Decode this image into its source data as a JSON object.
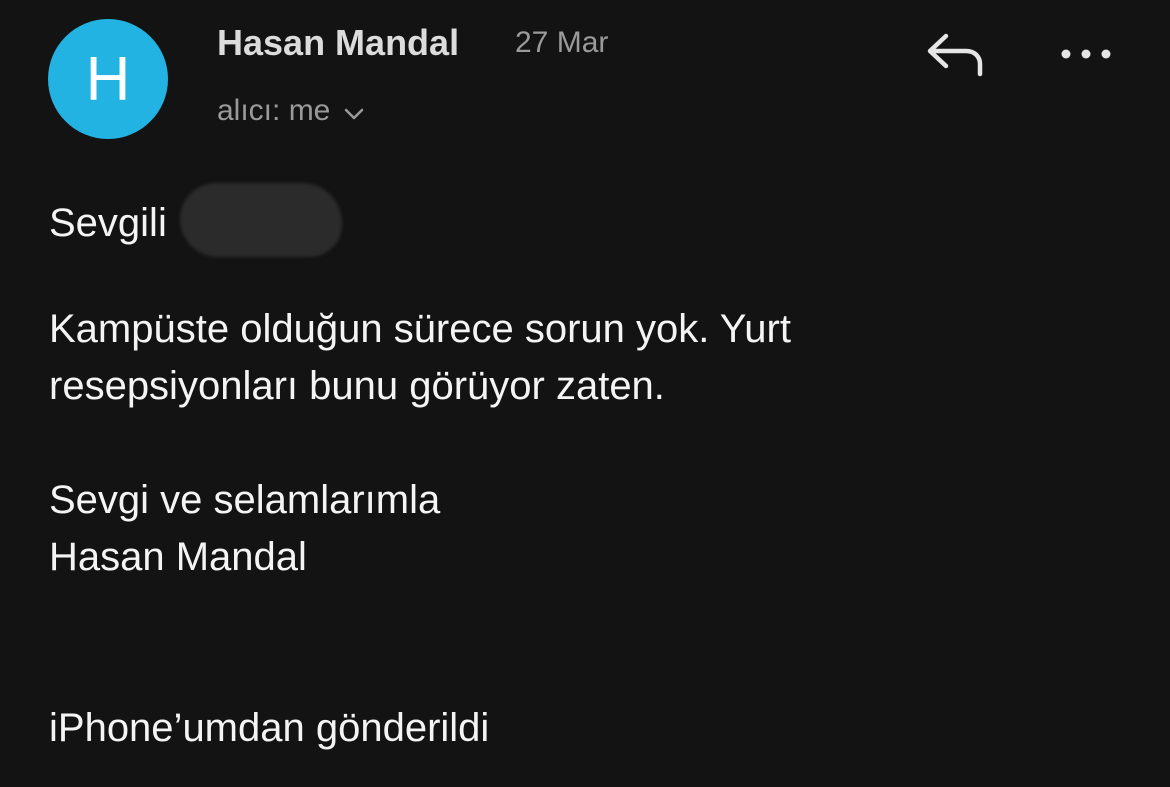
{
  "header": {
    "avatar_letter": "H",
    "avatar_color": "#22b3e2",
    "sender_name": "Hasan Mandal",
    "date": "27 Mar",
    "recipient": "alıcı: me",
    "recipient_toggle_icon": "chevron-down-icon",
    "reply_icon": "reply-icon",
    "more_icon": "more-horizontal-icon"
  },
  "message": {
    "greeting": "Sevgili",
    "paragraph1": [
      "Kampüste olduğun sürece sorun yok. Yurt",
      "resepsiyonları bunu görüyor zaten."
    ],
    "closing": [
      "Sevgi ve selamlarımla",
      "Hasan Mandal"
    ],
    "signature": "iPhone’umdan gönderildi"
  },
  "colors": {
    "background": "#131313",
    "text": "#f4f4f4",
    "secondary_text": "#9a9a9a"
  }
}
